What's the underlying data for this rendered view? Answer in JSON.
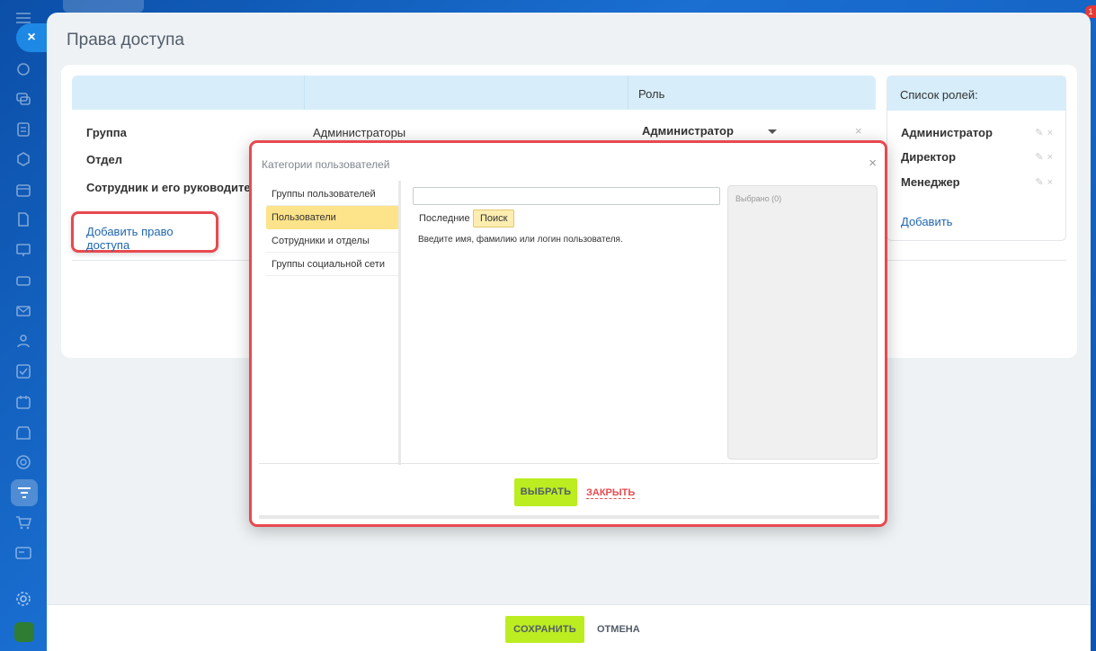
{
  "rail": {
    "close_label": "×",
    "badge": "1",
    "icons": [
      "comments-icon",
      "chat-icon",
      "feed-icon",
      "crm-icon",
      "calendar-icon",
      "document-icon",
      "board-icon",
      "storage-icon",
      "mail-icon",
      "contacts-icon",
      "tasks-icon",
      "schedule-icon",
      "store-icon",
      "goals-icon",
      "filter-icon",
      "cart-icon",
      "id-card-icon"
    ]
  },
  "page": {
    "title": "Права доступа"
  },
  "table": {
    "role_header": "Роль",
    "rows": [
      {
        "label": "Группа",
        "value": "Администраторы",
        "role": "Администратор"
      },
      {
        "label": "Отдел",
        "value": "",
        "role": ""
      },
      {
        "label": "Сотрудник и его руководители",
        "value": "",
        "role": ""
      }
    ],
    "add_access_link": "Добавить право доступа",
    "remove_icon": "×"
  },
  "roles": {
    "header": "Список ролей:",
    "items": [
      "Администратор",
      "Директор",
      "Менеджер"
    ],
    "edit_icon": "✎",
    "delete_icon": "×",
    "add_link": "Добавить"
  },
  "popup": {
    "title": "Категории пользователей",
    "close_icon": "×",
    "categories": [
      "Группы пользователей",
      "Пользователи",
      "Сотрудники и отделы",
      "Группы социальной сети"
    ],
    "selected_category_index": 1,
    "search_value": "",
    "tab_recent": "Последние",
    "tab_search": "Поиск",
    "hint": "Введите имя, фамилию или логин пользователя.",
    "selected_label": "Выбрано (0)",
    "choose_button": "ВЫБРАТЬ",
    "close_button": "ЗАКРЫТЬ"
  },
  "footer": {
    "save_button": "СОХРАНИТЬ",
    "cancel_button": "ОТМЕНА"
  },
  "colors": {
    "accent_green": "#bbed21",
    "link_blue": "#2067b0",
    "highlight_red": "#e8494f",
    "header_blue": "#d7eefa",
    "selected_yellow": "#fde38a"
  }
}
